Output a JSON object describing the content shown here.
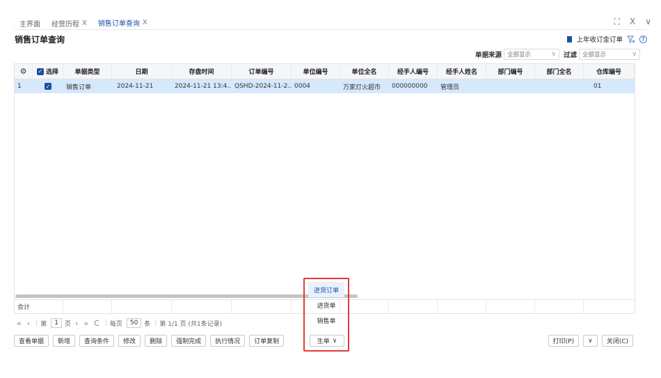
{
  "tabs": [
    {
      "label": "主界面",
      "closable": false,
      "active": false
    },
    {
      "label": "经营历程",
      "closable": true,
      "active": false
    },
    {
      "label": "销售订单查询",
      "closable": true,
      "active": true
    }
  ],
  "tab_close_glyph": "X",
  "window_controls": {
    "fullscreen": "⛶",
    "close": "X",
    "collapse": "∨"
  },
  "page_title": "销售订单查询",
  "top_right": {
    "label": "上年收订金订单"
  },
  "filters": {
    "source_label": "单据来源",
    "source_value": "全部显示",
    "filter_label": "过滤",
    "filter_value": "全部显示"
  },
  "table": {
    "columns": [
      "",
      "选择",
      "单据类型",
      "日期",
      "存盘时间",
      "订单编号",
      "单位编号",
      "单位全名",
      "经手人编号",
      "经手人姓名",
      "部门编号",
      "部门全名",
      "仓库编号"
    ],
    "rows": [
      {
        "index": "1",
        "checked": true,
        "type": "销售订单",
        "date": "2024-11-21",
        "save_time": "2024-11-21 13:4...",
        "order_no": "QSHD-2024-11-2...",
        "unit_code": "0004",
        "unit_name": "万家灯火超市",
        "handler_code": "000000000",
        "handler_name": "管理员",
        "dept_code": "",
        "dept_name": "",
        "warehouse_code": "01"
      }
    ],
    "summary_label": "合计"
  },
  "pager": {
    "first": "«",
    "prev": "‹",
    "next": "›",
    "last": "»",
    "refresh": "C",
    "page_prefix": "第",
    "page_value": "1",
    "page_suffix": "页",
    "per_page_prefix": "每页",
    "per_page_value": "50",
    "per_page_suffix": "条",
    "info": "第 1/1 页 (共1条记录)"
  },
  "buttons": {
    "view": "查看单据",
    "add": "新增",
    "query": "查询条件",
    "edit": "修改",
    "delete": "删除",
    "force_complete": "强制完成",
    "exec_status": "执行情况",
    "copy_order": "订单复制",
    "generate": "生单",
    "print": "打印(P)",
    "print_more": "∨",
    "close": "关闭(C)"
  },
  "generate_menu": [
    "进货订单",
    "进货单",
    "销售单"
  ],
  "colors": {
    "accent": "#1a4fa8",
    "row_selected": "#d6e8fb",
    "highlight_border": "#e03b3b"
  }
}
